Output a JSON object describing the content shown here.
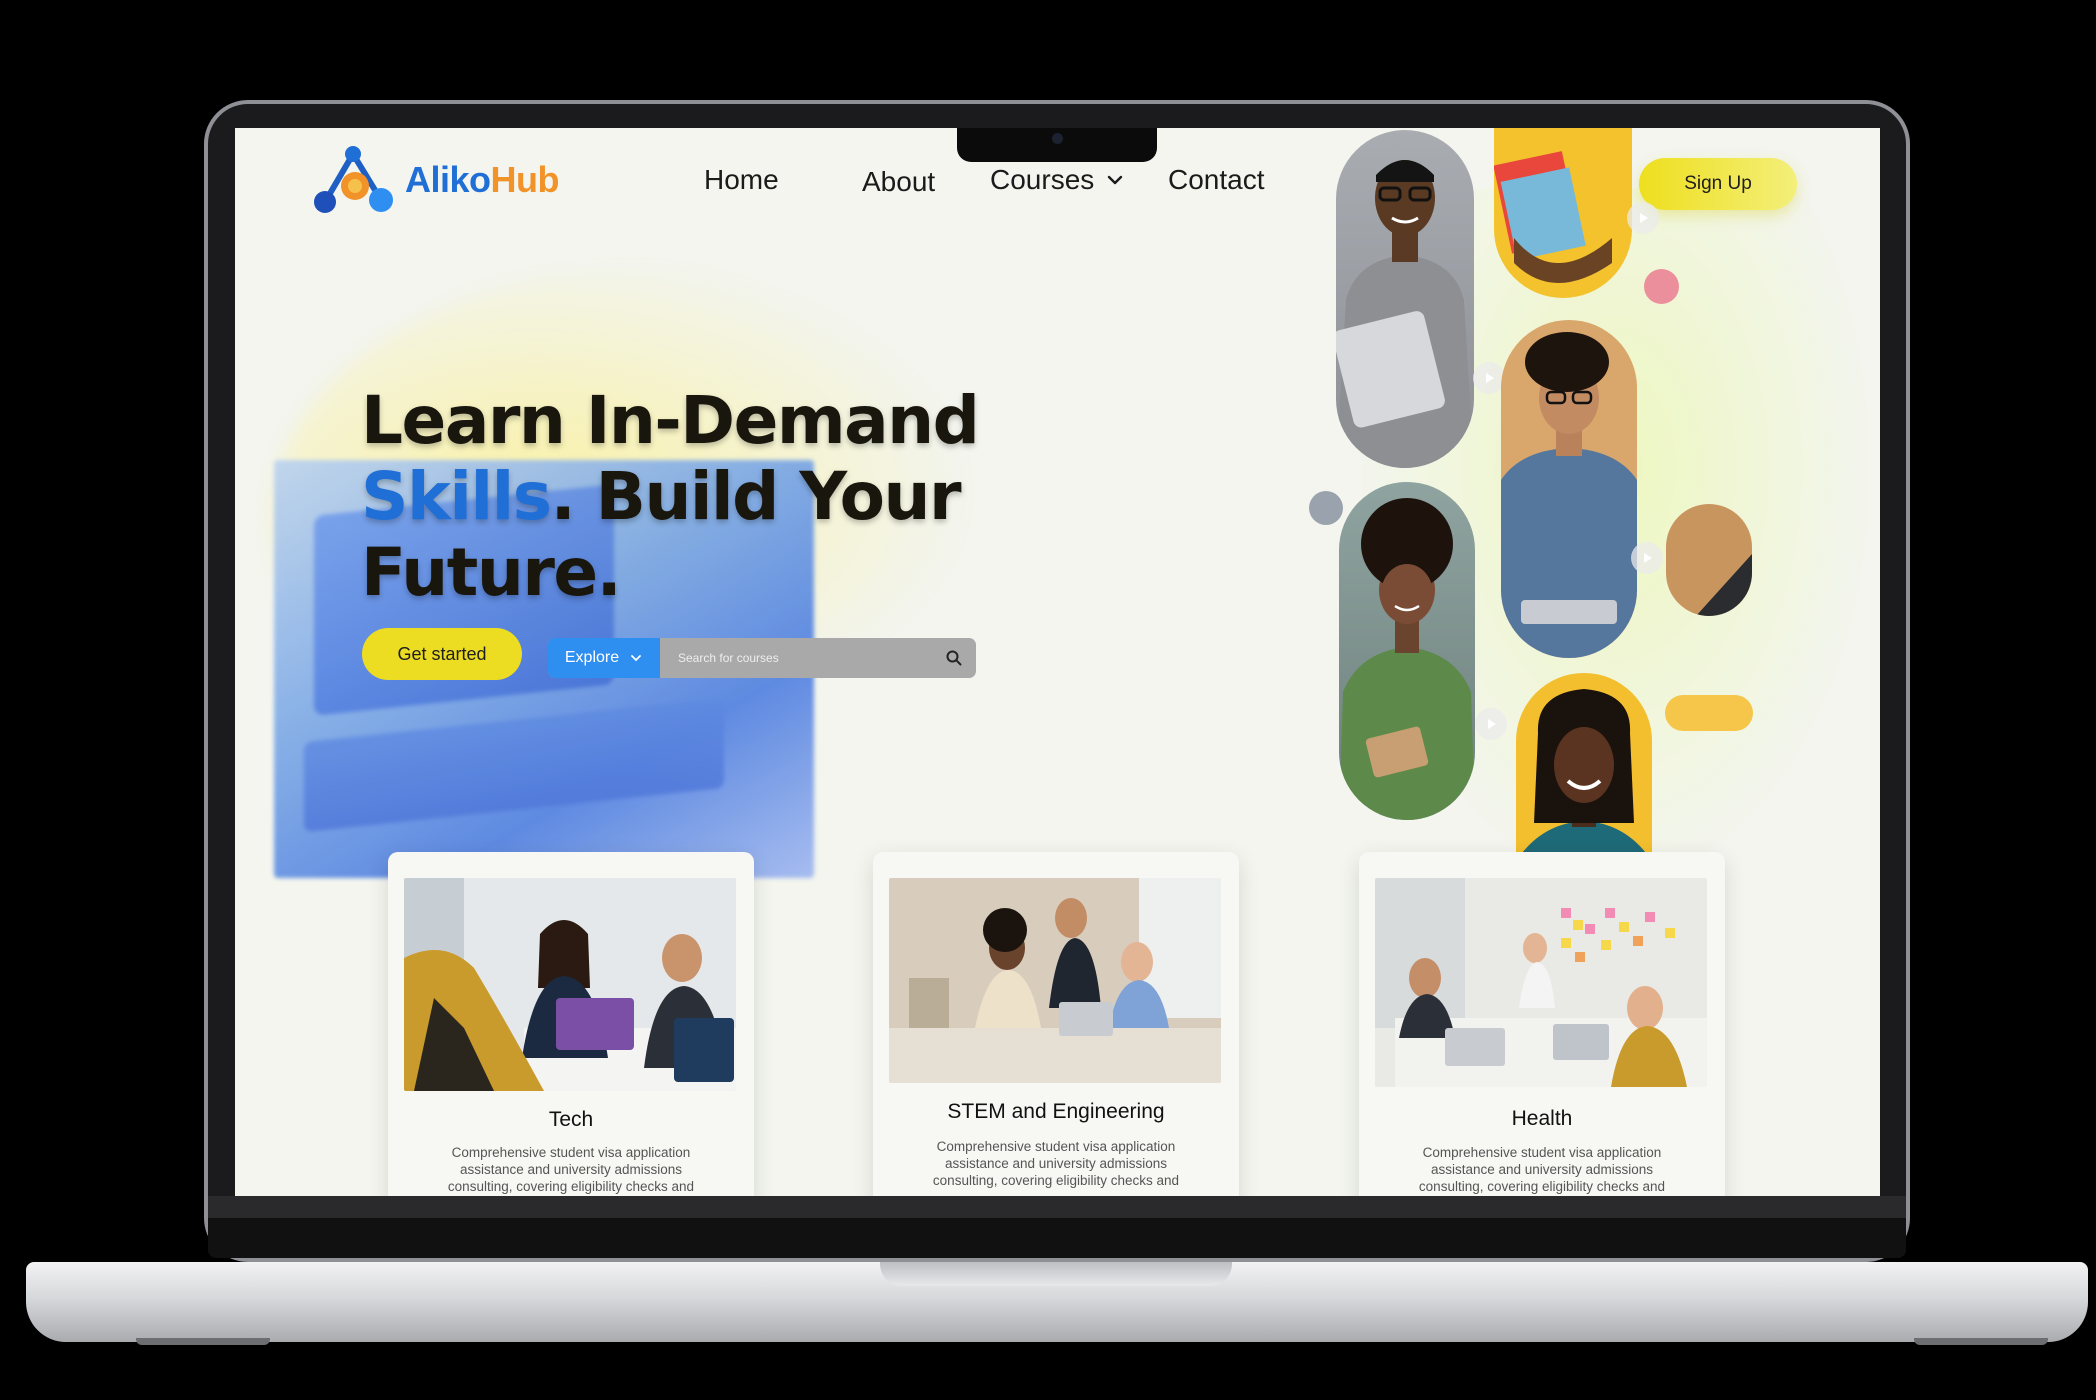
{
  "brand": {
    "name_part1": "Aliko",
    "name_part2": "Hub"
  },
  "nav": {
    "home": "Home",
    "about": "About",
    "courses": "Courses",
    "contact": "Contact"
  },
  "signup_label": "Sign Up",
  "hero": {
    "line1": "Learn In-Demand",
    "line2_accent": "Skills",
    "line2_rest": ". Build Your",
    "line3": "Future."
  },
  "cta": {
    "get_started": "Get started"
  },
  "search": {
    "explore_label": "Explore",
    "placeholder": "Search for courses"
  },
  "cards": [
    {
      "title": "Tech",
      "description": "Comprehensive student visa application assistance and university admissions consulting, covering eligibility checks and"
    },
    {
      "title": "STEM and Engineering",
      "description": "Comprehensive student visa application assistance and university admissions consulting, covering eligibility checks and"
    },
    {
      "title": "Health",
      "description": "Comprehensive student visa application assistance and university admissions consulting, covering eligibility checks and"
    }
  ],
  "colors": {
    "brand_blue": "#1f6fd6",
    "brand_orange": "#f2932a",
    "accent_yellow": "#ecdc22",
    "explore_blue": "#2f8ff0"
  },
  "icons": [
    "logo-icon",
    "chevron-down-icon",
    "search-icon",
    "play-icon"
  ]
}
